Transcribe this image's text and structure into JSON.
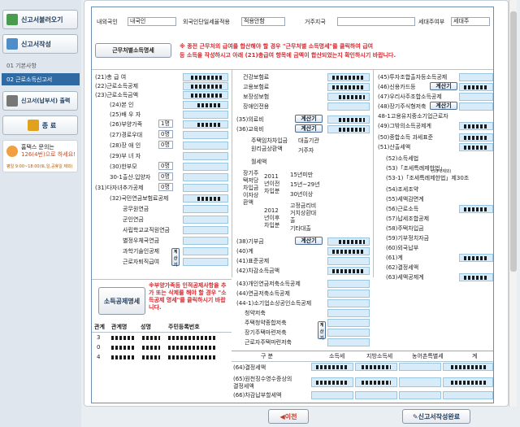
{
  "sidebar": {
    "btn_load": "신고서불러오기",
    "btn_write": "신고서작성",
    "step1": "01 기본사항",
    "step2": "02 근로소득신고서",
    "btn_print": "신고서(납부서) 출력",
    "btn_exit": "종 료",
    "help_line1": "홈택스 문의는",
    "help_line2": "126(4번)으로 하세요!",
    "help_line3": "평일 9:00~18:00(토,일,공휴일 제외)"
  },
  "top": {
    "col_nation": "내외국인",
    "nation_value": "내국인",
    "col_flat": "외국인단일세율적용",
    "flat_value": "적용안함",
    "col_region": "거주지국",
    "col_head": "세대주여부",
    "head_value": "세대주"
  },
  "notice": {
    "company_button": "근무처별소득명세",
    "text1": "※ 종전 근무처의 급여를 합산해야 할 경우 \"근무처별 소득명세\"를 클릭하여 급여",
    "text2": "등 소득을 작성하시고 아래 (21)총급여 항목에 금액이 합산되었는지 확인하시기 바랍니다."
  },
  "col1": {
    "r21": "(21)총 급 여",
    "r22": "(22)근로소득공제",
    "r23": "(23)근로소득금액",
    "r24": "(24)본 인",
    "r25": "(25)배 우 자",
    "r26": "(26)부양가족",
    "r26_unit": "1명",
    "r27": "(27)경로우대",
    "r27_unit": "0명",
    "r28": "(28)장 애 인",
    "r28_unit": "0명",
    "r29": "(29)부 녀 자",
    "r30": "(30)한부모",
    "r30_unit": "0명",
    "r30_1": "30-1출산.입양자",
    "r30_1_unit": "0명",
    "r31": "(31)다자녀추가공제",
    "r31_unit": "0명",
    "r32": "(32)국민연금보험료공제",
    "p1": "공무원연금",
    "p2": "군인연금",
    "p3": "사립학교교직원연금",
    "p4": "별정우체국연금",
    "p5": "과학기술인공제",
    "p6": "근로자퇴직급여",
    "grp_basic": "기본공제",
    "grp_add": "추가공제",
    "grp_multi": "다자녀",
    "grp_pension": "연금보험료공제",
    "grp_other": "공적연금",
    "calc": "계산기"
  },
  "col2": {
    "health": "건강보험료",
    "employ": "고용보험료",
    "guarantee": "보장성보험",
    "disabled_ins": "장애인전용",
    "r35": "(35)의료비",
    "r36": "(36)교육비",
    "house_loan": "주택임차차입금",
    "house_repay": "원리금상환액",
    "lender": "대출기관",
    "resident": "거주자",
    "rent": "월세액",
    "long_term": "장기주택저당차입금이자상환액",
    "y2011": "2011년이전차입분",
    "y15": "15년미만",
    "y15_29": "15년~29년",
    "y30": "30년이상",
    "y2012": "2012년이후차입분",
    "fixed": "고정금리비거치상환대출",
    "etc_loan": "기타대출",
    "r38": "(38)기부금",
    "r40": "(40)계",
    "r41": "(41)표준공제",
    "r42": "(42)차감소득금액",
    "calc": "계산기",
    "grp_special": "특별공제"
  },
  "col3": {
    "r45": "(45)투자조합출자등소득공제",
    "r46": "(46)신용카드등",
    "r47": "(47)우리사주조합소득공제",
    "r48": "(48)장기주식형저축",
    "r48_1": "48-1고용유지중소기업근로자",
    "r49": "(49)그밖의소득공제계",
    "r50": "(50)종합소득 과세표준",
    "r51": "(51)산출세액",
    "r52": "(52)소득세법",
    "r53": "(53)「조세특례제한법」",
    "r53_1": "(53-1)「조세특례제한법」제30조",
    "r53_1b": "(53-1제외)",
    "r54": "(54)조세조약",
    "r55": "(55)세액감면계",
    "r56": "(56)근로소득",
    "r57": "(57)납세조합공제",
    "r58": "(58)주택차입금",
    "r59": "(59)기부정치자금",
    "r60": "(60)외국납부",
    "r61": "(61)계",
    "r62": "(62)결정세액",
    "r63": "(63)세액공제계",
    "calc": "계산기",
    "grp_reduce": "세액감면",
    "grp_credit": "세액공제"
  },
  "lower": {
    "deduct_button": "소득공제명세",
    "note": "※부양가족등 인적공제사항을 추가 또는 삭제를 해야 할 경우 \"소득공제 명세\"를 클릭하시기 바랍니다.",
    "headers": [
      "관계",
      "관계명",
      "성명",
      "주민등록번호"
    ],
    "rows": [
      "3",
      "0",
      "4"
    ],
    "r43": "(43)개인연금저축소득공제",
    "r44": "(44)연금저축소득공제",
    "r44_1": "(44-1)소기업소상공인소득공제",
    "savings": "청약저축",
    "house_sub": "주택청약종합저축",
    "long_house": "장기주택마련저축",
    "worker_house": "근로자주택마련저축",
    "grp_other_ded": "그밖의소득공제",
    "calc": "계산기"
  },
  "summary": {
    "headers": [
      "구 분",
      "소득세",
      "지방소득세",
      "농어촌특별세",
      "계"
    ],
    "r64": "(64)결정세액",
    "r65": "(65)원천징수영수증상의 결정세액",
    "r66": "(66)차감납부할세액"
  },
  "bottom": {
    "prev": "이전",
    "done": "신고서작성완료"
  }
}
